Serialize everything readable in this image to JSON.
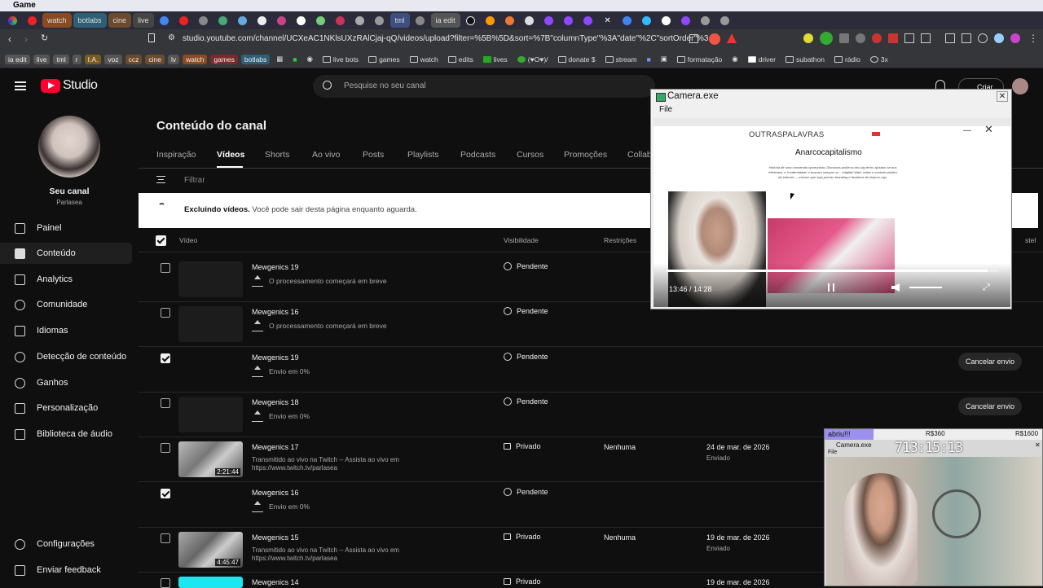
{
  "window": {
    "title": "Game"
  },
  "browser_tabs": [
    "watch",
    "botlabs",
    "cine",
    "live",
    "ia edit",
    "tml"
  ],
  "tab_close_glyph": "✕",
  "address": {
    "url": "studio.youtube.com/channel/UCXeAC1NKlsUXzRAlCjaj-qQ/videos/upload?filter=%5B%5D&sort=%7B\"columnType\"%3A\"date\"%2C\"sortOrder\"%3..."
  },
  "bookmarks": {
    "chips": [
      "ia edit",
      "live",
      "tml",
      "r",
      "I.A.",
      "voz",
      "ccz",
      "cine",
      "lv",
      "watch",
      "games",
      "botlabs"
    ],
    "folders": [
      "live bots",
      "games",
      "watch",
      "edits",
      "lives",
      "(♥O♥)/",
      "donate $",
      "stream",
      "formatação",
      "driver",
      "subathon",
      "rádio",
      "3x"
    ]
  },
  "header": {
    "logo_text": "Studio",
    "search_placeholder": "Pesquise no seu canal",
    "create_label": "Criar"
  },
  "sidebar": {
    "channel_label": "Seu canal",
    "channel_name": "Parlasea",
    "items": [
      "Painel",
      "Conteúdo",
      "Analytics",
      "Comunidade",
      "Idiomas",
      "Detecção de conteúdo",
      "Ganhos",
      "Personalização",
      "Biblioteca de áudio"
    ],
    "bottom": [
      "Configurações",
      "Enviar feedback"
    ]
  },
  "main": {
    "page_title": "Conteúdo do canal",
    "tabs": [
      "Inspiração",
      "Vídeos",
      "Shorts",
      "Ao vivo",
      "Posts",
      "Playlists",
      "Podcasts",
      "Cursos",
      "Promoções",
      "Collab"
    ],
    "filter_label": "Filtrar",
    "banner_bold": "Excluindo vídeos.",
    "banner_text": "Você pode sair desta página enquanto aguarda.",
    "columns": {
      "video": "Vídeo",
      "visibility": "Visibilidade",
      "restrictions": "Restrições",
      "extra": "stel"
    },
    "rows": [
      {
        "title": "Mewgenics 19",
        "sub": "O processamento começará em breve",
        "vis": "Pendente",
        "checked": false
      },
      {
        "title": "Mewgenics 16",
        "sub": "O processamento começará em breve",
        "vis": "Pendente",
        "checked": false
      },
      {
        "title": "Mewgenics 19",
        "sub": "Envio em 0%",
        "vis": "Pendente",
        "checked": true,
        "cancel": "Cancelar envio"
      },
      {
        "title": "Mewgenics 18",
        "sub": "Envio em 0%",
        "vis": "Pendente",
        "checked": false,
        "cancel": "Cancelar envio"
      },
      {
        "title": "Mewgenics 17",
        "desc": "Transmitido ao vivo na Twitch -- Assista ao vivo em https://www.twitch.tv/parlasea",
        "vis": "Privado",
        "restr": "Nenhuma",
        "date": "24 de mar. de 2026",
        "date_status": "Enviado",
        "duration": "2:21:44",
        "checked": false
      },
      {
        "title": "Mewgenics 16",
        "sub": "Envio em 0%",
        "vis": "Pendente",
        "checked": true
      },
      {
        "title": "Mewgenics 15",
        "desc": "Transmitido ao vivo na Twitch -- Assista ao vivo em https://www.twitch.tv/parlasea",
        "vis": "Privado",
        "restr": "Nenhuma",
        "date": "19 de mar. de 2026",
        "date_status": "Enviado",
        "duration": "4:45:47",
        "checked": false
      },
      {
        "title": "Mewgenics 14",
        "vis": "Privado",
        "date": "19 de mar. de 2026",
        "checked": false
      }
    ]
  },
  "camera_window": {
    "title": "Camera.exe",
    "menu": "File",
    "site": "OUTRASPALAVRAS",
    "article_title": "Anarcocapitalismo",
    "article_lead": "História de uma conversão oportunista. Discursos políticos dos big techs ajustam-se aos 'eficientes' e 'modernidade' e buscam sempre no... religião! Mais: evitar o controle público da internet — mesmo que seja preciso branding e fanáticos do Anarco-cap.",
    "time": "13:46 / 14:28",
    "progress": 0.965
  },
  "mini_overlay": {
    "label": "abriu!!!",
    "goal_left": "R$360",
    "goal_right": "R$1600",
    "title": "Camera.exe",
    "menu": "File",
    "timer": "713:15:13"
  },
  "colors": {
    "accent": "#ff0033",
    "bg": "#0f0f0f",
    "goal_bar": "#9b8ff0"
  }
}
